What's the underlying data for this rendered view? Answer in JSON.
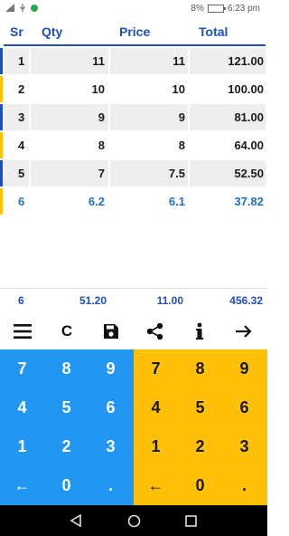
{
  "status": {
    "battery": "8%",
    "time": "6:23 pm"
  },
  "header": {
    "sr": "Sr",
    "qty": "Qty",
    "price": "Price",
    "total": "Total"
  },
  "rows": [
    {
      "sr": "1",
      "qty": "11",
      "price": "11",
      "total": "121.00"
    },
    {
      "sr": "2",
      "qty": "10",
      "price": "10",
      "total": "100.00"
    },
    {
      "sr": "3",
      "qty": "9",
      "price": "9",
      "total": "81.00"
    },
    {
      "sr": "4",
      "qty": "8",
      "price": "8",
      "total": "64.00"
    },
    {
      "sr": "5",
      "qty": "7",
      "price": "7.5",
      "total": "52.50"
    },
    {
      "sr": "6",
      "qty": "6.2",
      "price": "6.1",
      "total": "37.82"
    }
  ],
  "summary": {
    "count": "6",
    "qty_sum": "51.20",
    "price_sum": "11.00",
    "total_sum": "456.32"
  },
  "toolbar": {
    "clear_label": "C"
  },
  "keypad_left": [
    "7",
    "8",
    "9",
    "4",
    "5",
    "6",
    "1",
    "2",
    "3",
    "←",
    "0",
    "."
  ],
  "keypad_right": [
    "7",
    "8",
    "9",
    "4",
    "5",
    "6",
    "1",
    "2",
    "3",
    "←",
    "0",
    "."
  ],
  "colors": {
    "accent": "#1f4fb8",
    "left_panel": "#2196f3",
    "right_panel": "#ffc107",
    "row_bar_blue": "#1f4fb8",
    "row_bar_yellow": "#ffc107"
  },
  "icons": [
    "menu-icon",
    "save-icon",
    "share-icon",
    "info-icon",
    "arrow-right-icon",
    "back-nav-icon",
    "home-nav-icon",
    "recents-nav-icon"
  ]
}
